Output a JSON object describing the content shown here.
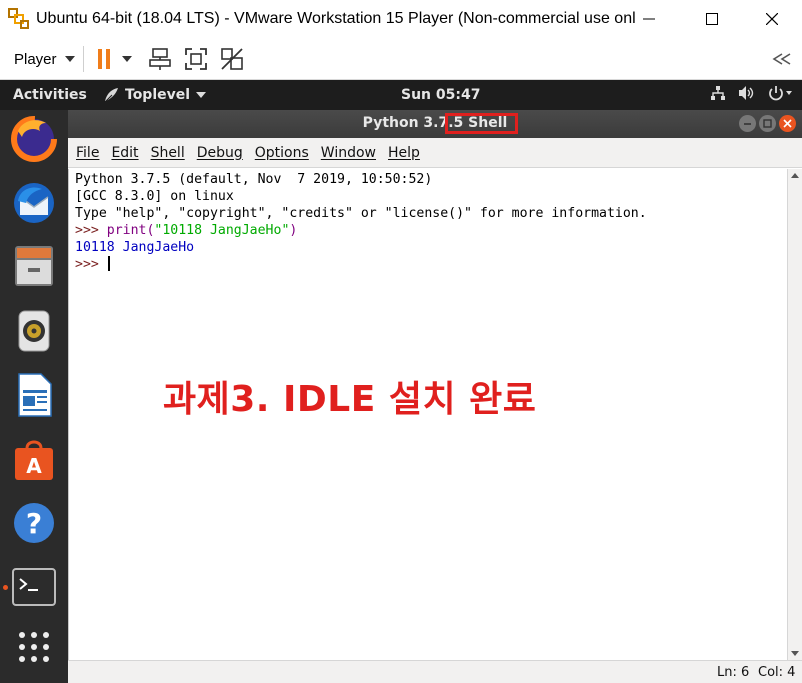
{
  "vm_window": {
    "title": "Ubuntu 64-bit (18.04 LTS) - VMware Workstation 15 Player (Non-commercial use onl...",
    "icon": "vmware-logo-icon"
  },
  "vm_toolbar": {
    "player_label": "Player",
    "pause_icon": "pause-icon",
    "send_ctrl_alt_del_icon": "network-send-icon",
    "fit_guest_icon": "fit-screen-icon",
    "unity_icon": "unity-off-icon",
    "collapse_icon": "double-chevron-left-icon"
  },
  "ubuntu_topbar": {
    "activities": "Activities",
    "app_menu": "Toplevel",
    "clock": "Sun 05:47"
  },
  "dock": {
    "items": [
      {
        "name": "firefox",
        "icon": "firefox-icon"
      },
      {
        "name": "thunderbird",
        "icon": "thunderbird-icon"
      },
      {
        "name": "files",
        "icon": "files-icon"
      },
      {
        "name": "rhythmbox",
        "icon": "rhythmbox-icon"
      },
      {
        "name": "libreoffice-writer",
        "icon": "writer-icon"
      },
      {
        "name": "ubuntu-software",
        "icon": "software-icon"
      },
      {
        "name": "help",
        "icon": "help-icon"
      },
      {
        "name": "terminal",
        "icon": "terminal-icon"
      },
      {
        "name": "show-applications",
        "icon": "apps-grid-icon"
      }
    ]
  },
  "idle": {
    "title": "Python 3.7.5 Shell",
    "menu": [
      "File",
      "Edit",
      "Shell",
      "Debug",
      "Options",
      "Window",
      "Help"
    ],
    "shell": {
      "banner_line1": "Python 3.7.5 (default, Nov  7 2019, 10:50:52)",
      "banner_line2": "[GCC 8.3.0] on linux",
      "banner_line3": "Type \"help\", \"copyright\", \"credits\" or \"license()\" for more information.",
      "prompt": ">>> ",
      "cmd_func": "print(",
      "cmd_string": "\"10118 JangJaeHo\"",
      "cmd_close": ")",
      "output": "10118 JangJaeHo",
      "prompt2": ">>> "
    },
    "status": {
      "line": "Ln: 6",
      "col": "Col: 4"
    }
  },
  "annotation": "과제3. IDLE 설치 완료",
  "colors": {
    "annotation_red": "#e0201e",
    "ubuntu_orange": "#e95420",
    "pause_orange": "#f07d1a"
  }
}
